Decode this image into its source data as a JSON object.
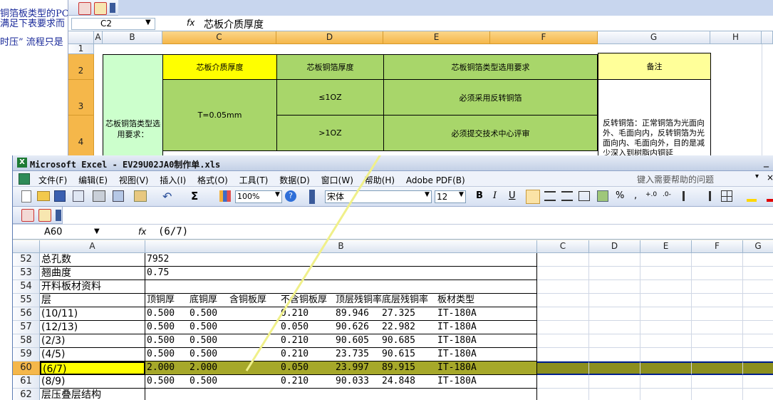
{
  "doc": {
    "lines": [
      "铜箔板类型的PC",
      "满足下表要求而",
      "时压” 流程只是"
    ]
  },
  "bg_excel": {
    "namebox": "C2",
    "fx": "fx",
    "formula": "芯板介质厚度",
    "columns": [
      "A",
      "B",
      "C",
      "D",
      "E",
      "F",
      "G",
      "H"
    ],
    "rows": [
      "1",
      "2",
      "3",
      "4"
    ],
    "table": {
      "h1": "芯板介质厚度",
      "h2": "芯板铜箔厚度",
      "h3": "芯板铜箔类型选用要求",
      "h4": "备注",
      "t": "T=0.05mm",
      "d1": "≤1OZ",
      "d2": ">1OZ",
      "e1": "必须采用反转铜箔",
      "e2": "必须提交技术中心评审",
      "b": "芯板铜箔类型选用要求：",
      "note": "反转铜箔：正常铜箔为光面向外、毛面向内，反转铜箔为光面向内、毛面向外，目的是减少深入到树脂内铜延"
    },
    "colors": {
      "yellow": "#ffff00",
      "green": "#a8d66a",
      "lightgreen": "#ccffcc",
      "noteyellow": "#ffff99"
    }
  },
  "front": {
    "title": "Microsoft Excel - EV29U02JA0制作单.xls",
    "menu": [
      "文件(F)",
      "编辑(E)",
      "视图(V)",
      "插入(I)",
      "格式(O)",
      "工具(T)",
      "数据(D)",
      "窗口(W)",
      "帮助(H)",
      "Adobe PDF(B)"
    ],
    "help_placeholder": "键入需要帮助的问题",
    "zoom": "100%",
    "font": "宋体",
    "font_size": "12",
    "bold": "B",
    "italic": "I",
    "underline": "U",
    "namebox": "A60",
    "fx": "fx",
    "formula": "(6/7)",
    "columns": [
      "A",
      "B",
      "C",
      "D",
      "E",
      "F",
      "G"
    ],
    "rows": [
      {
        "n": "52",
        "a": "总孔数",
        "b": [
          "7952"
        ]
      },
      {
        "n": "53",
        "a": "翘曲度",
        "b": [
          "0.75"
        ]
      },
      {
        "n": "54",
        "a": "开料板材资料",
        "b": []
      },
      {
        "n": "55",
        "a": "层",
        "b": [
          "顶铜厚",
          "底铜厚",
          "含铜板厚",
          "不含铜板厚",
          "顶层残铜率",
          "底层残铜率",
          "板材类型"
        ]
      },
      {
        "n": "56",
        "a": "(10/11)",
        "b": [
          "0.500",
          "0.500",
          "",
          "0.210",
          "89.946",
          "27.325",
          "IT-180A"
        ]
      },
      {
        "n": "57",
        "a": "(12/13)",
        "b": [
          "0.500",
          "0.500",
          "",
          "0.050",
          "90.626",
          "22.982",
          "IT-180A"
        ]
      },
      {
        "n": "58",
        "a": "(2/3)",
        "b": [
          "0.500",
          "0.500",
          "",
          "0.210",
          "90.605",
          "90.685",
          "IT-180A"
        ]
      },
      {
        "n": "59",
        "a": "(4/5)",
        "b": [
          "0.500",
          "0.500",
          "",
          "0.210",
          "23.735",
          "90.615",
          "IT-180A"
        ]
      },
      {
        "n": "60",
        "a": "(6/7)",
        "b": [
          "2.000",
          "2.000",
          "",
          "0.050",
          "23.997",
          "89.915",
          "IT-180A"
        ]
      },
      {
        "n": "61",
        "a": "(8/9)",
        "b": [
          "0.500",
          "0.500",
          "",
          "0.210",
          "90.033",
          "24.848",
          "IT-180A"
        ]
      },
      {
        "n": "62",
        "a": "层压叠层结构",
        "b": []
      }
    ],
    "colors": {
      "selected_row": "#a6a82a",
      "selected_a": "#ffff00",
      "arrow": "#f0f08a"
    }
  }
}
